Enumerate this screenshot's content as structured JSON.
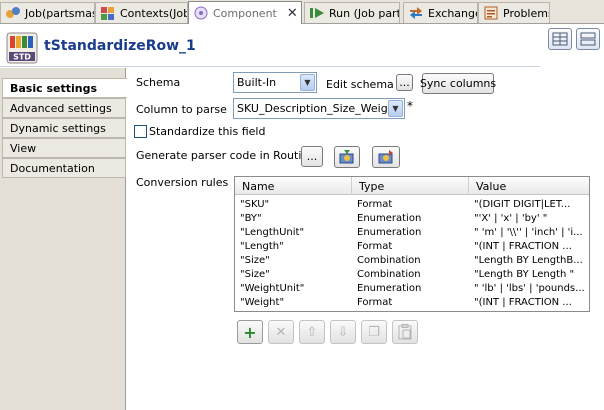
{
  "tabs": [
    {
      "label": "Job(partsmas",
      "icon": "job-icon"
    },
    {
      "label": "Contexts(Job",
      "icon": "contexts-icon"
    },
    {
      "label": "Component",
      "icon": "component-icon",
      "active": true,
      "close": "✕"
    },
    {
      "label": "Run (Job part",
      "icon": "run-icon"
    },
    {
      "label": "Exchange",
      "icon": "exchange-icon"
    },
    {
      "label": "Problems",
      "icon": "problems-icon"
    }
  ],
  "header": {
    "title": "tStandardizeRow_1",
    "icon_text": "STD"
  },
  "nav": [
    {
      "label": "Basic settings",
      "active": true
    },
    {
      "label": "Advanced settings"
    },
    {
      "label": "Dynamic settings"
    },
    {
      "label": "View"
    },
    {
      "label": "Documentation"
    }
  ],
  "form": {
    "schema_label": "Schema",
    "schema_value": "Built-In",
    "edit_schema_label": "Edit schema",
    "ellipsis": "...",
    "sync_columns": "Sync columns",
    "column_label": "Column to parse",
    "column_value": "SKU_Description_Size_Weight",
    "required_mark": "*",
    "standardize_label": "Standardize this field",
    "generate_label": "Generate parser code in Routines",
    "conversion_label": "Conversion rules"
  },
  "table": {
    "columns": [
      "Name",
      "Type",
      "Value"
    ],
    "rows": [
      [
        "\"SKU\"",
        "Format",
        "\"(DIGIT DIGIT|LET..."
      ],
      [
        "\"BY\"",
        "Enumeration",
        "\"'X' | 'x' | 'by' \""
      ],
      [
        "\"LengthUnit\"",
        "Enumeration",
        "\" 'm' | '\\\\'' | 'inch' | 'i..."
      ],
      [
        "\"Length\"",
        "Format",
        "\"(INT | FRACTION ..."
      ],
      [
        "\"Size\"",
        "Combination",
        "\"Length BY LengthB..."
      ],
      [
        "\"Size\"",
        "Combination",
        "\"Length BY Length \""
      ],
      [
        "\"WeightUnit\"",
        "Enumeration",
        "\" 'lb' | 'lbs' | 'pounds..."
      ],
      [
        "\"Weight\"",
        "Format",
        "\"(INT | FRACTION ..."
      ]
    ]
  },
  "toolbar": {
    "add": "+",
    "remove": "✕",
    "up": "⇧",
    "down": "⇩",
    "copy": "❐",
    "paste": "📋"
  }
}
